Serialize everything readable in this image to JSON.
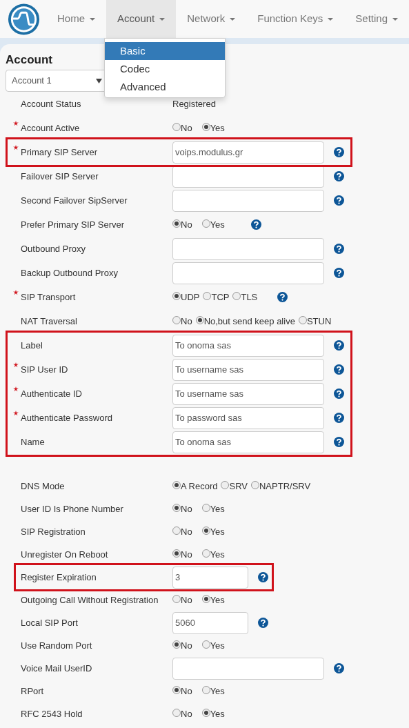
{
  "nav": {
    "items": [
      {
        "label": "Home",
        "selected": false
      },
      {
        "label": "Account",
        "selected": true
      },
      {
        "label": "Network",
        "selected": false
      },
      {
        "label": "Function Keys",
        "selected": false
      },
      {
        "label": "Setting",
        "selected": false
      }
    ]
  },
  "dropdown": {
    "items": [
      {
        "label": "Basic",
        "selected": true
      },
      {
        "label": "Codec",
        "selected": false
      },
      {
        "label": "Advanced",
        "selected": false
      }
    ]
  },
  "page_title": "Account",
  "account_select": {
    "value": "Account 1"
  },
  "fieldsets": [
    {
      "sections": [
        {
          "highlighted": false,
          "rows": [
            {
              "kind": "text",
              "label": "Account Status",
              "required": false,
              "value": "Registered"
            },
            {
              "kind": "radio",
              "label": "Account Active",
              "required": true,
              "help": false,
              "options": [
                {
                  "label": "No",
                  "selected": false
                },
                {
                  "label": "Yes",
                  "selected": true
                }
              ]
            }
          ]
        },
        {
          "highlighted": true,
          "rows": [
            {
              "kind": "input",
              "label": "Primary SIP Server",
              "required": true,
              "value": "voips.modulus.gr",
              "short": false,
              "help": true
            }
          ]
        },
        {
          "highlighted": false,
          "rows": [
            {
              "kind": "input",
              "label": "Failover SIP Server",
              "required": false,
              "short": false,
              "help": true
            },
            {
              "kind": "input",
              "label": "Second Failover SipServer",
              "required": false,
              "short": false,
              "help": true
            },
            {
              "kind": "radio",
              "label": "Prefer Primary SIP Server",
              "required": false,
              "help": true,
              "options": [
                {
                  "label": "No",
                  "selected": true
                },
                {
                  "label": "Yes",
                  "selected": false
                }
              ]
            },
            {
              "kind": "input",
              "label": "Outbound Proxy",
              "required": false,
              "short": false,
              "help": true
            },
            {
              "kind": "input",
              "label": "Backup Outbound Proxy",
              "required": false,
              "short": false,
              "help": true
            },
            {
              "kind": "radio",
              "label": "SIP Transport",
              "required": true,
              "help": true,
              "options": [
                {
                  "label": "UDP",
                  "selected": true
                },
                {
                  "label": "TCP",
                  "selected": false
                },
                {
                  "label": "TLS",
                  "selected": false
                }
              ]
            },
            {
              "kind": "radio",
              "label": "NAT Traversal",
              "required": false,
              "help": false,
              "options": [
                {
                  "label": "No",
                  "selected": false
                },
                {
                  "label": "No,but send keep alive",
                  "selected": true
                },
                {
                  "label": "STUN",
                  "selected": false
                }
              ]
            }
          ]
        },
        {
          "highlighted": true,
          "rows": [
            {
              "kind": "input",
              "label": "Label",
              "required": false,
              "value": "To onoma sas",
              "short": false,
              "help": true
            },
            {
              "kind": "input",
              "label": "SIP User ID",
              "required": true,
              "value": "To username sas",
              "short": false,
              "help": true
            },
            {
              "kind": "input",
              "label": "Authenticate ID",
              "required": true,
              "value": "To username sas",
              "short": false,
              "help": true
            },
            {
              "kind": "input",
              "label": "Authenticate Password",
              "required": true,
              "value": "To password sas",
              "short": false,
              "help": true
            },
            {
              "kind": "input",
              "label": "Name",
              "required": false,
              "value": "To onoma sas",
              "short": false,
              "help": true
            }
          ]
        }
      ]
    },
    {
      "sections": [
        {
          "highlighted": false,
          "rows": [
            {
              "kind": "radio",
              "label": "DNS Mode",
              "required": false,
              "help": false,
              "options": [
                {
                  "label": "A Record",
                  "selected": true
                },
                {
                  "label": "SRV",
                  "selected": false
                },
                {
                  "label": "NAPTR/SRV",
                  "selected": false
                }
              ]
            },
            {
              "kind": "radio",
              "label": "User ID Is Phone Number",
              "required": false,
              "help": false,
              "options": [
                {
                  "label": "No",
                  "selected": true
                },
                {
                  "label": "Yes",
                  "selected": false
                }
              ]
            },
            {
              "kind": "radio",
              "label": "SIP Registration",
              "required": false,
              "help": false,
              "options": [
                {
                  "label": "No",
                  "selected": false
                },
                {
                  "label": "Yes",
                  "selected": true
                }
              ]
            },
            {
              "kind": "radio",
              "label": "Unregister On Reboot",
              "required": false,
              "help": false,
              "options": [
                {
                  "label": "No",
                  "selected": true
                },
                {
                  "label": "Yes",
                  "selected": false
                }
              ]
            }
          ]
        },
        {
          "highlighted": true,
          "rows": [
            {
              "kind": "input",
              "label": "Register Expiration",
              "required": false,
              "value": "3",
              "short": true,
              "help": true
            }
          ]
        },
        {
          "highlighted": false,
          "rows": [
            {
              "kind": "radio",
              "label": "Outgoing Call Without Registration",
              "required": false,
              "help": false,
              "options": [
                {
                  "label": "No",
                  "selected": false
                },
                {
                  "label": "Yes",
                  "selected": true
                }
              ]
            },
            {
              "kind": "input",
              "label": "Local SIP Port",
              "required": false,
              "value": "5060",
              "short": true,
              "help": true
            },
            {
              "kind": "radio",
              "label": "Use Random Port",
              "required": false,
              "help": false,
              "options": [
                {
                  "label": "No",
                  "selected": true
                },
                {
                  "label": "Yes",
                  "selected": false
                }
              ]
            },
            {
              "kind": "input",
              "label": "Voice Mail UserID",
              "required": false,
              "short": false,
              "help": true
            },
            {
              "kind": "radio",
              "label": "RPort",
              "required": false,
              "help": false,
              "options": [
                {
                  "label": "No",
                  "selected": true
                },
                {
                  "label": "Yes",
                  "selected": false
                }
              ]
            },
            {
              "kind": "radio",
              "label": "RFC 2543 Hold",
              "required": false,
              "help": false,
              "options": [
                {
                  "label": "No",
                  "selected": false
                },
                {
                  "label": "Yes",
                  "selected": true
                }
              ]
            }
          ]
        }
      ]
    }
  ]
}
